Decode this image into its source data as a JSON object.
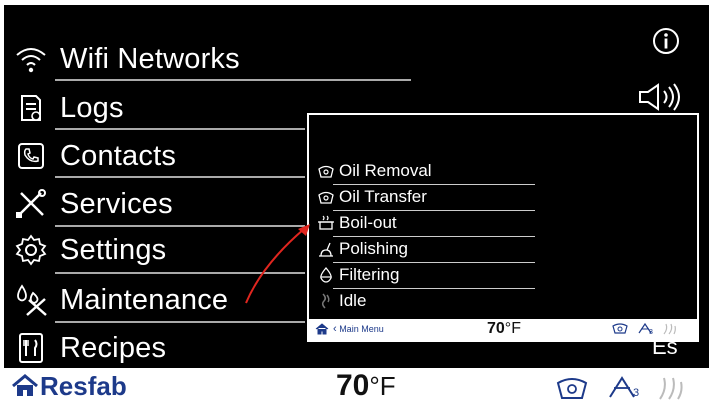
{
  "menu": [
    {
      "label": "Wifi Networks",
      "icon": "wifi-icon"
    },
    {
      "label": "Logs",
      "icon": "logs-icon"
    },
    {
      "label": "Contacts",
      "icon": "phone-icon"
    },
    {
      "label": "Services",
      "icon": "tools-icon"
    },
    {
      "label": "Settings",
      "icon": "gear-icon"
    },
    {
      "label": "Maintenance",
      "icon": "maintenance-icon"
    },
    {
      "label": "Recipes",
      "icon": "recipes-icon"
    }
  ],
  "top_right": {
    "info_icon": "info-icon",
    "sound_icon": "speaker-icon"
  },
  "bottom_bar": {
    "brand": "Resfab",
    "temp_value": "70",
    "temp_unit": "°F",
    "status_count": "3"
  },
  "language_label": "Es",
  "popup": {
    "items": [
      {
        "label": "Oil Removal",
        "icon": "oil-removal-icon"
      },
      {
        "label": "Oil Transfer",
        "icon": "oil-transfer-icon"
      },
      {
        "label": "Boil-out",
        "icon": "boil-out-icon"
      },
      {
        "label": "Polishing",
        "icon": "polishing-icon"
      },
      {
        "label": "Filtering",
        "icon": "filtering-icon"
      },
      {
        "label": "Idle",
        "icon": "idle-icon"
      }
    ],
    "bar": {
      "back_label": "Main Menu",
      "temp_value": "70",
      "temp_unit": "°F",
      "status_count": "3"
    }
  },
  "colors": {
    "brand": "#1d3a8a",
    "arrow": "#e0261f",
    "background": "#000000"
  }
}
